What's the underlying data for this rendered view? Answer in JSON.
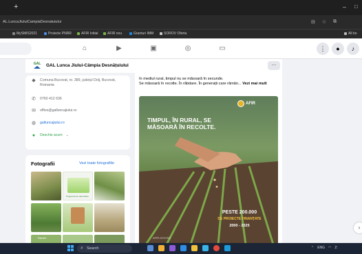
{
  "browser": {
    "url": "AL.LuncaJiuluiCampiaDesnatuiului",
    "bookmarks": [
      "MySMIS2021",
      "Proiecte PNRR",
      "AFIR Initial",
      "AFIR nou",
      "Granturi IMM",
      "SOROV Oferta"
    ],
    "all_bookmarks": "All bo"
  },
  "page": {
    "name": "GAL Lunca Jiului-Câmpia Desnățuiului",
    "logo_text": "GAL"
  },
  "intro": {
    "address": "Comuna Bucovat, nr. 389, județul Dolj, Bucovat, Romania",
    "phone": "0760 412 636",
    "email": "office@galluncajiului.ro",
    "website": "galluncajiului.ro",
    "hours": "Deschis acum"
  },
  "photos": {
    "title": "Fotografii",
    "see_all": "Vezi toate fotografiile",
    "thumb_text": "Programul de dezvoltare",
    "caption": "Înșiruire"
  },
  "post": {
    "text_line1": "în mediul rural, timpul nu se măsoară în secunde.",
    "text_line2": "Se măsoară în recolte. În răbdare. În generații care rămân...",
    "see_more": "Vezi mai mult",
    "image": {
      "brand": "AFIR",
      "headline": "Timpul, în rural, se măsoară în recolte.",
      "stat": "PESTE 200.000",
      "stat_sub": "DE PROIECTE FINANȚATE",
      "years": "2000 - 2025",
      "footer": "AFIR.GOV.RO"
    }
  },
  "taskbar": {
    "search": "Search",
    "lang": "ENG",
    "time": "2:"
  },
  "colors": {
    "accent": "#216fdb",
    "open": "#31a24c",
    "taskbar": "#1c2536"
  }
}
